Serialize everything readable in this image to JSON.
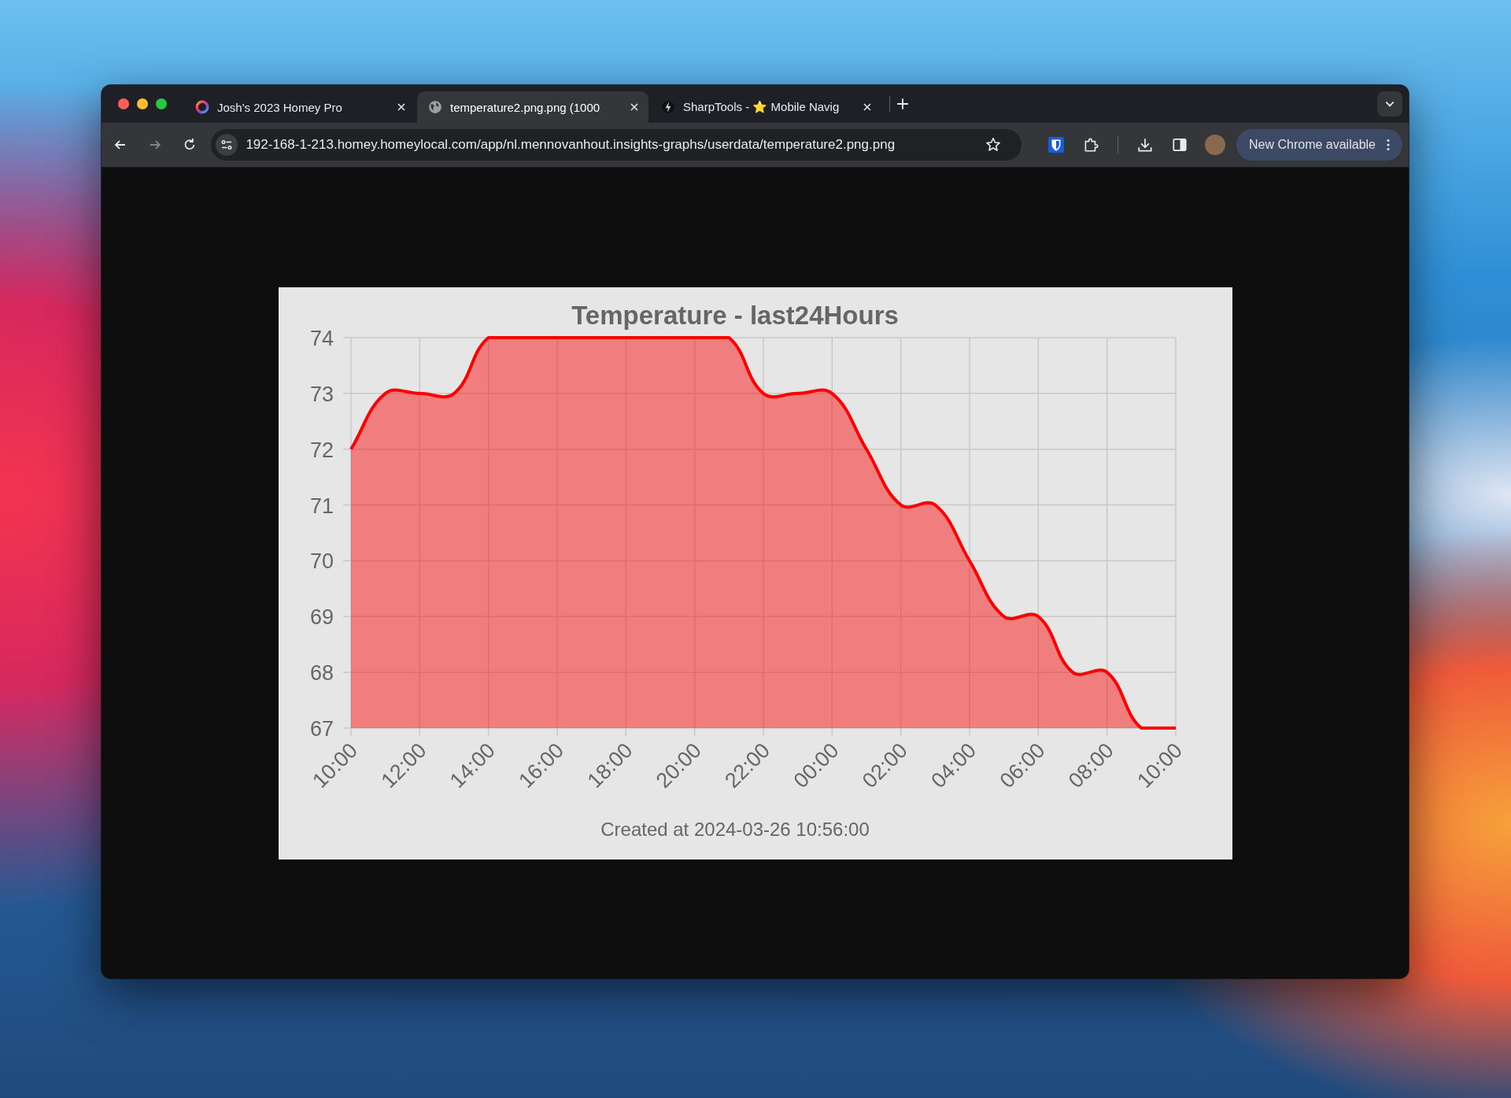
{
  "tabs": [
    {
      "kind": "homey",
      "title": "Josh's 2023 Homey Pro",
      "selected": false
    },
    {
      "kind": "globe",
      "title": "temperature2.png.png (1000",
      "selected": true
    },
    {
      "kind": "bolt",
      "title": "SharpTools - ⭐ Mobile Navig",
      "selected": false
    }
  ],
  "toolbar": {
    "nav": [
      {
        "kind": "back",
        "disabled": false
      },
      {
        "kind": "forward",
        "disabled": true
      },
      {
        "kind": "reload",
        "disabled": false
      }
    ],
    "address": "192-168-1-213.homey.homeylocal.com/app/nl.mennovanhout.insights-graphs/userdata/temperature2.png.png",
    "update_button": "New Chrome available"
  },
  "content": {
    "chart_data": {
      "type": "area",
      "title": "Temperature - last24Hours",
      "xlabel": "Created at 2024-03-26 10:56:00",
      "categories": [
        "10:00",
        null,
        "12:00",
        null,
        "14:00",
        null,
        "16:00",
        null,
        "18:00",
        null,
        "20:00",
        null,
        "22:00",
        null,
        "00:00",
        null,
        "02:00",
        null,
        "04:00",
        null,
        "06:00",
        null,
        "08:00",
        null,
        "10:00"
      ],
      "series": [
        {
          "color": "#ff0000",
          "values": [
            72,
            73,
            73,
            73,
            74,
            74,
            74,
            74,
            74,
            74,
            74,
            74,
            73,
            73,
            73,
            72,
            71,
            71,
            70,
            69,
            69,
            68,
            68,
            67,
            67
          ]
        }
      ],
      "ylim": [
        67,
        74
      ],
      "grid": true,
      "yticks": [
        67,
        68,
        69,
        70,
        71,
        72,
        73,
        74
      ]
    }
  }
}
